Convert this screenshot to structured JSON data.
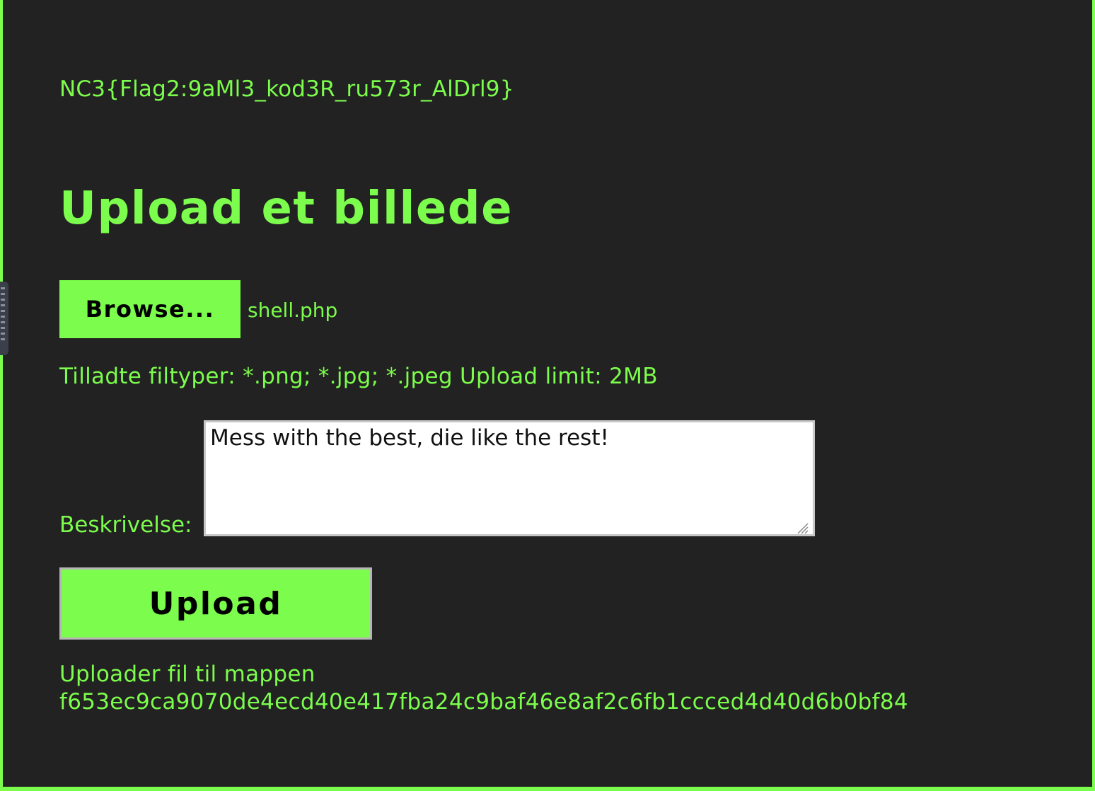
{
  "flag_text": "NC3{Flag2:9aMl3_kod3R_ru573r_AlDrl9}",
  "page_title": "Upload et billede",
  "file_input": {
    "browse_label": "Browse...",
    "selected_file": "shell.php"
  },
  "allowed_types_text": "Tilladte filtyper: *.png; *.jpg; *.jpeg Upload limit: 2MB",
  "description": {
    "label": "Beskrivelse:",
    "value": "Mess with the best, die like the rest!"
  },
  "upload_button_label": "Upload",
  "status": {
    "line1": "Uploader fil til mappen",
    "line2": "f653ec9ca9070de4ecd40e417fba24c9baf46e8af2c6fb1ccced4d40d6b0bf84"
  },
  "colors": {
    "accent": "#7cfc4c",
    "background": "#222222",
    "text_dark": "#000000"
  },
  "icons": {
    "resize_grip": "resize-grip-icon",
    "side_handle": "drag-handle-icon"
  }
}
